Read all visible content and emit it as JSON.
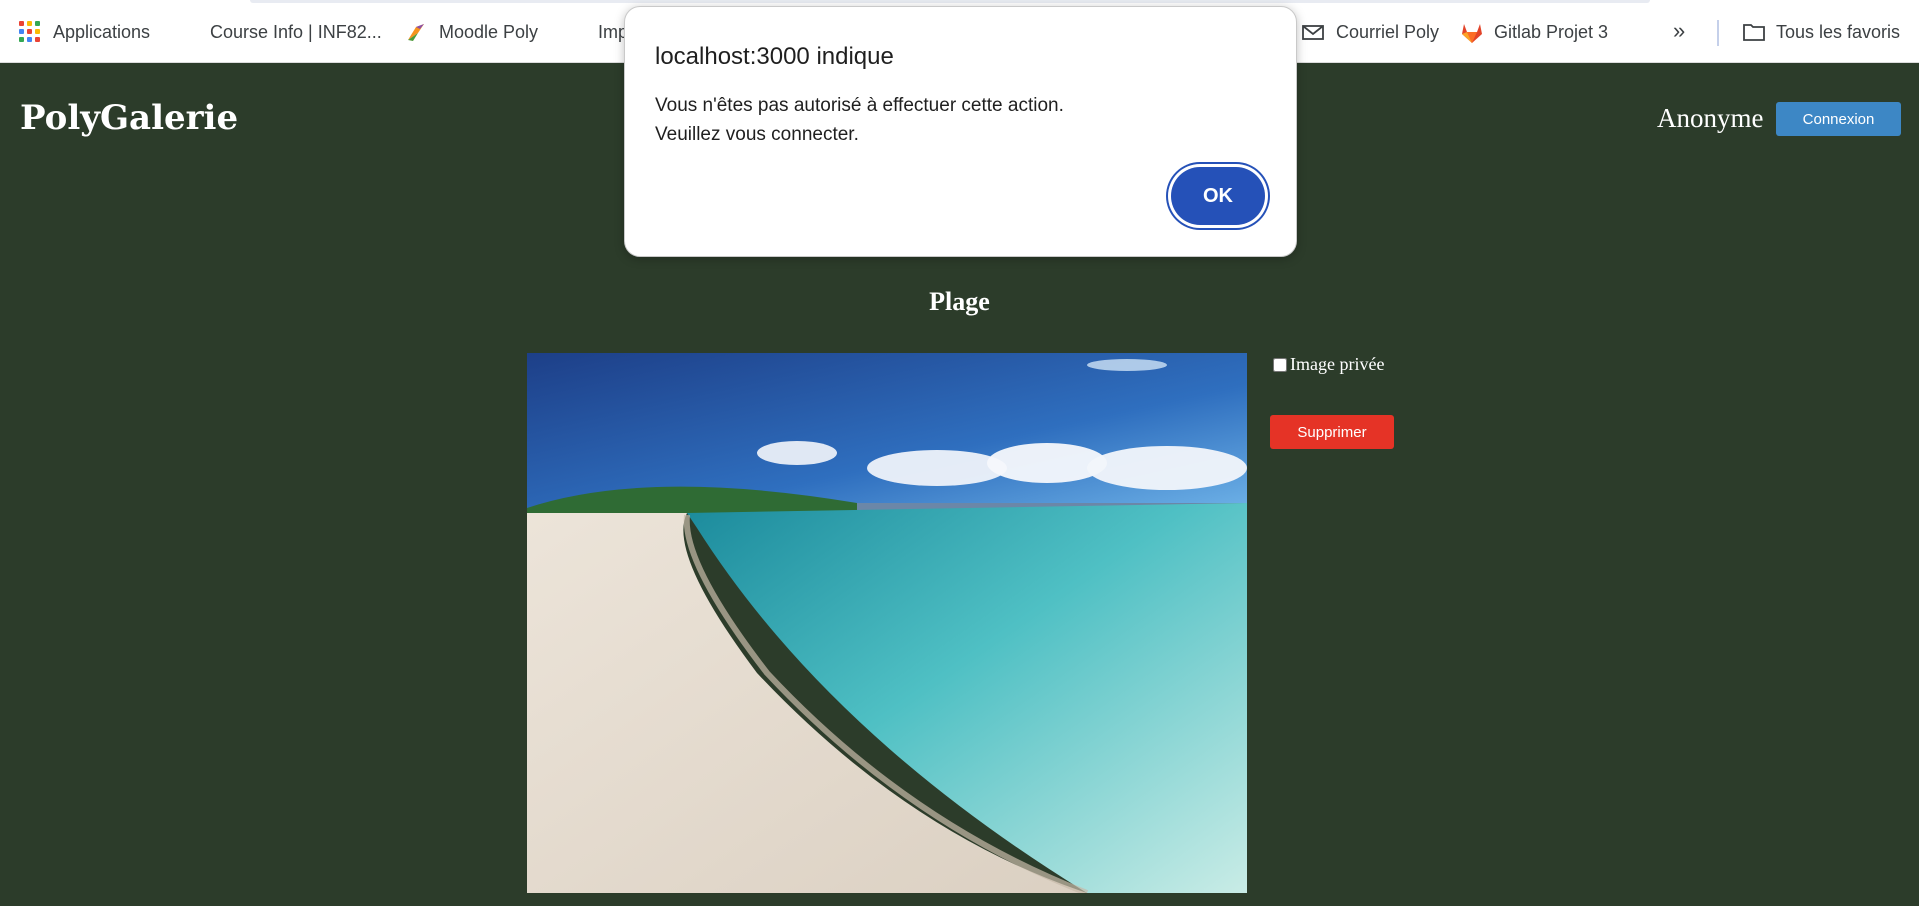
{
  "bookmarks": {
    "items": [
      {
        "label": "Applications",
        "icon": "apps-grid-icon"
      },
      {
        "label": "Course Info | INF82...",
        "icon": "globe-icon"
      },
      {
        "label": "Moodle Poly",
        "icon": "moodle-icon"
      },
      {
        "label": "Imp",
        "icon": "globe-icon"
      },
      {
        "label": "Courriel Poly",
        "icon": "mail-icon"
      },
      {
        "label": "Gitlab Projet 3",
        "icon": "gitlab-icon"
      }
    ],
    "overflow": "»",
    "all_bookmarks": "Tous les favoris"
  },
  "header": {
    "brand": "PolyGalerie",
    "user": "Anonyme",
    "login_label": "Connexion"
  },
  "content": {
    "title": "Plage",
    "private_label": "Image privée",
    "private_checked": false,
    "delete_label": "Supprimer"
  },
  "dialog": {
    "title": "localhost:3000 indique",
    "message_line1": "Vous n'êtes pas autorisé à effectuer cette action.",
    "message_line2": "Veuillez vous connecter.",
    "ok_label": "OK"
  },
  "colors": {
    "background": "#2c3c2a",
    "login_button": "#3d87c5",
    "delete_button": "#e53326",
    "dialog_button": "#2551b8"
  }
}
